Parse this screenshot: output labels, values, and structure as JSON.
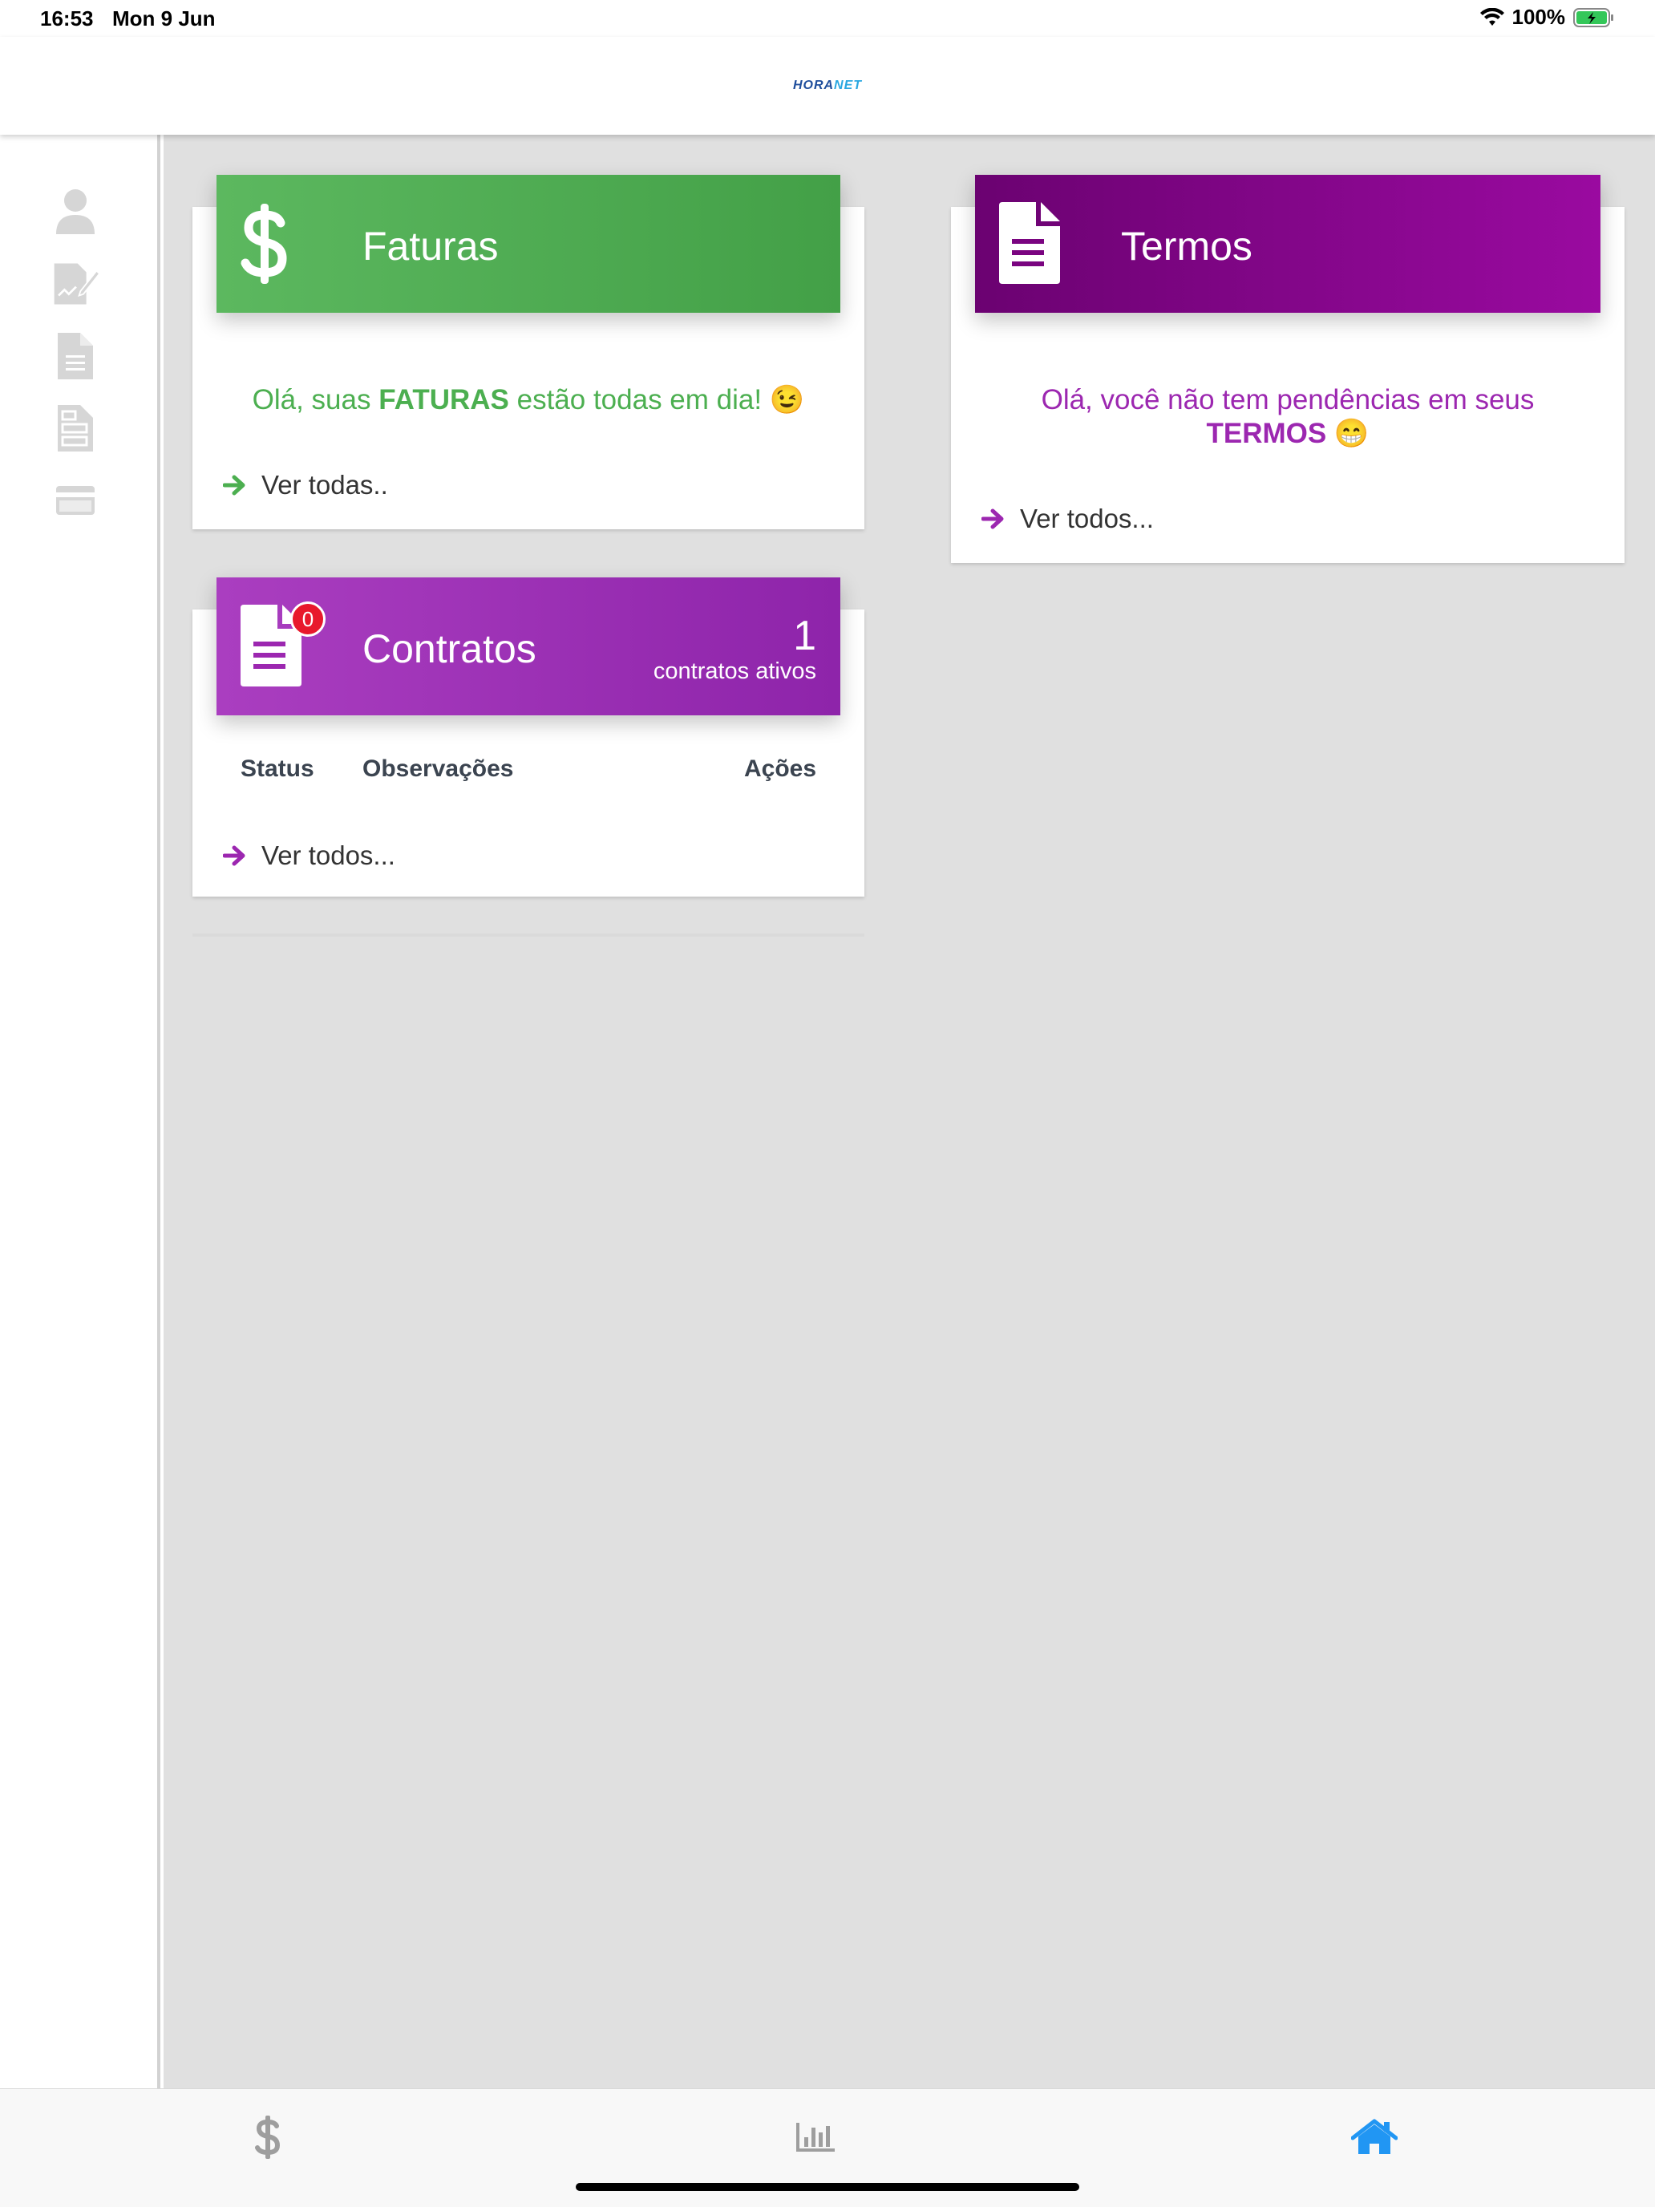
{
  "status_bar": {
    "time": "16:53",
    "date": "Mon 9 Jun",
    "battery": "100%"
  },
  "header": {
    "logo_left": "HORA",
    "logo_right": "NET"
  },
  "sidebar": {
    "items": [
      {
        "icon": "user-icon"
      },
      {
        "icon": "signature-icon"
      },
      {
        "icon": "document-icon"
      },
      {
        "icon": "documents-icon"
      },
      {
        "icon": "credit-card-icon"
      }
    ]
  },
  "cards": {
    "faturas": {
      "title": "Faturas",
      "message_before": "Olá, suas ",
      "message_bold": "FATURAS",
      "message_after": " estão todas em dia! 😉",
      "link": "Ver todas..",
      "color": "#4caf50"
    },
    "termos": {
      "title": "Termos",
      "message_line1": "Olá, você não tem pendências em seus",
      "message_bold": "TERMOS",
      "message_emoji": " 😁",
      "link": "Ver todos...",
      "color": "#8e0e93"
    },
    "contratos": {
      "title": "Contratos",
      "badge": "0",
      "count": "1",
      "count_label": "contratos ativos",
      "columns": [
        "Status",
        "Observações",
        "Ações"
      ],
      "link": "Ver todos...",
      "color": "#9c27b0"
    }
  },
  "tabbar": {
    "tabs": [
      {
        "icon": "dollar-icon",
        "active": false
      },
      {
        "icon": "bar-chart-icon",
        "active": false
      },
      {
        "icon": "home-icon",
        "active": true
      }
    ],
    "active_color": "#2196f3",
    "inactive_color": "#9e9e9e"
  }
}
